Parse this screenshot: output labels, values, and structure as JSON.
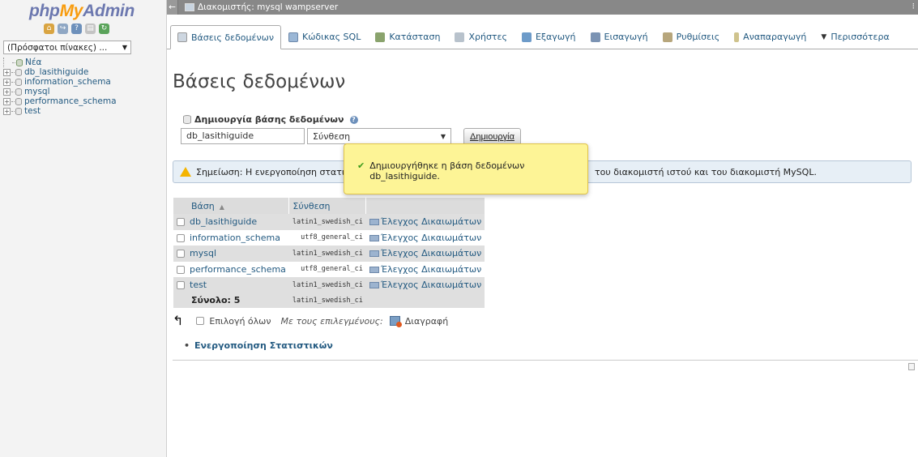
{
  "nav": {
    "logo_php": "php",
    "logo_my": "My",
    "logo_admin": "Admin",
    "recent_label": "(Πρόσφατοι πίνακες) ...",
    "tree": [
      {
        "label": "Νέα",
        "type": "new"
      },
      {
        "label": "db_lasithiguide",
        "type": "db"
      },
      {
        "label": "information_schema",
        "type": "db"
      },
      {
        "label": "mysql",
        "type": "db"
      },
      {
        "label": "performance_schema",
        "type": "db"
      },
      {
        "label": "test",
        "type": "db"
      }
    ]
  },
  "serverbar": {
    "title": "Διακομιστής: mysql wampserver"
  },
  "tabs": [
    {
      "label": "Βάσεις δεδομένων",
      "icon": "database-icon",
      "color": "#cdd6e0"
    },
    {
      "label": "Κώδικας SQL",
      "icon": "sql-icon",
      "color": "#9bb7d6"
    },
    {
      "label": "Κατάσταση",
      "icon": "status-icon",
      "color": "#8aa36d"
    },
    {
      "label": "Χρήστες",
      "icon": "users-icon",
      "color": "#b8c2cc"
    },
    {
      "label": "Εξαγωγή",
      "icon": "export-icon",
      "color": "#6d9bc9"
    },
    {
      "label": "Εισαγωγή",
      "icon": "import-icon",
      "color": "#7b93b3"
    },
    {
      "label": "Ρυθμίσεις",
      "icon": "wrench-icon",
      "color": "#b7a67c"
    },
    {
      "label": "Αναπαραγωγή",
      "icon": "replication-icon",
      "color": "#cfc38d"
    },
    {
      "label": "Περισσότερα",
      "icon": "chevron-down-icon",
      "color": "#333333"
    }
  ],
  "main": {
    "title": "Βάσεις δεδομένων",
    "create": {
      "title": "Δημιουργία βάσης δεδομένων",
      "name_value": "db_lasithiguide",
      "collation_value": "Σύνθεση",
      "button": "Δημιουργία"
    },
    "notice_left": "Σημείωση: Η ενεργοποίηση στατιστικ",
    "notice_right": "του διακομιστή ιστού και του διακομιστή MySQL.",
    "success": "Δημιουργήθηκε η βάση δεδομένων db_lasithiguide."
  },
  "table": {
    "col_db": "Βάση",
    "col_collation": "Σύνθεση",
    "rows": [
      {
        "db": "db_lasithiguide",
        "collation": "latin1_swedish_ci",
        "priv": "Έλεγχος Δικαιωμάτων"
      },
      {
        "db": "information_schema",
        "collation": "utf8_general_ci",
        "priv": "Έλεγχος Δικαιωμάτων"
      },
      {
        "db": "mysql",
        "collation": "latin1_swedish_ci",
        "priv": "Έλεγχος Δικαιωμάτων"
      },
      {
        "db": "performance_schema",
        "collation": "utf8_general_ci",
        "priv": "Έλεγχος Δικαιωμάτων"
      },
      {
        "db": "test",
        "collation": "latin1_swedish_ci",
        "priv": "Έλεγχος Δικαιωμάτων"
      }
    ],
    "total_label": "Σύνολο: 5",
    "total_collation": "latin1_swedish_ci"
  },
  "bulk": {
    "select_all": "Επιλογή όλων",
    "with_selected": "Με τους επιλεγμένους:",
    "delete": "Διαγραφή"
  },
  "stats_link": "Ενεργοποίηση Στατιστικών"
}
